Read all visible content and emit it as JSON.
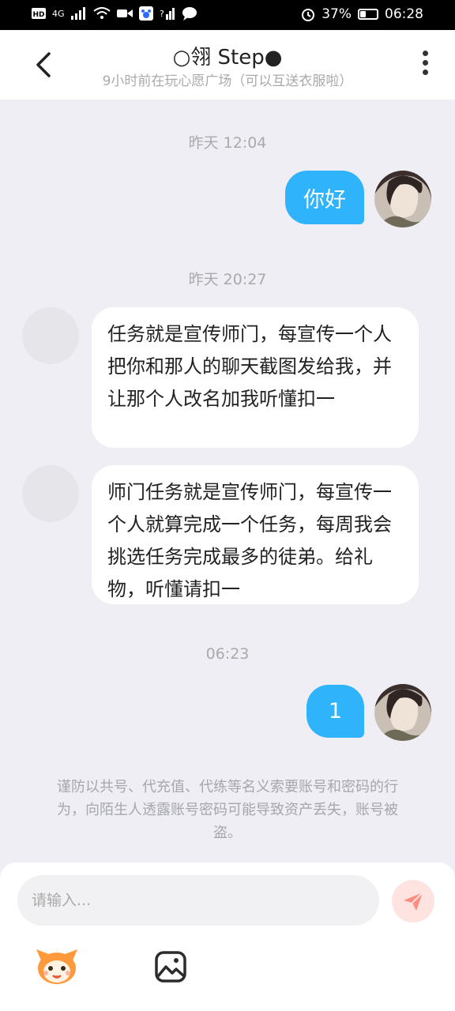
{
  "status_bar": {
    "network": "4G",
    "battery_percent": "37%",
    "battery_level": 0.37,
    "time": "06:28"
  },
  "header": {
    "title": "○翎 Step●",
    "subtitle": "9小时前在玩心愿广场（可以互送衣服啦）"
  },
  "messages": [
    {
      "timestamp": "昨天 12:04"
    },
    {
      "outgoing_1": "你好"
    },
    {
      "timestamp": "昨天 20:27"
    },
    {
      "incoming_1": "任务就是宣传师门，每宣传一个人把你和那人的聊天截图发给我，并让那个人改名加我听懂扣一"
    },
    {
      "incoming_2": "师门任务就是宣传师门，每宣传一个人就算完成一个任务，每周我会挑选任务完成最多的徒弟。给礼物，听懂请扣一"
    },
    {
      "timestamp": "06:23"
    },
    {
      "outgoing_2": "1"
    }
  ],
  "chat": {
    "ts1": "昨天 12:04",
    "out1": "你好",
    "ts2": "昨天 20:27",
    "in1": "任务就是宣传师门，每宣传一个人把你和那人的聊天截图发给我，并让那个人改名加我听懂扣一",
    "in2": "师门任务就是宣传师门，每宣传一个人就算完成一个任务，每周我会挑选任务完成最多的徒弟。给礼物，听懂请扣一",
    "ts3": "06:23",
    "out2": "1"
  },
  "warning": "谨防以共号、代充值、代练等名义索要账号和密码的行为，向陌生人透露账号密码可能导致资产丢失，账号被盗。",
  "input": {
    "placeholder": "请输入..."
  },
  "colors": {
    "accent_blue": "#2fb3fa",
    "send_button_bg": "#ffe3e0",
    "send_icon": "#ff7d6e",
    "chat_bg": "#eeeef4"
  }
}
